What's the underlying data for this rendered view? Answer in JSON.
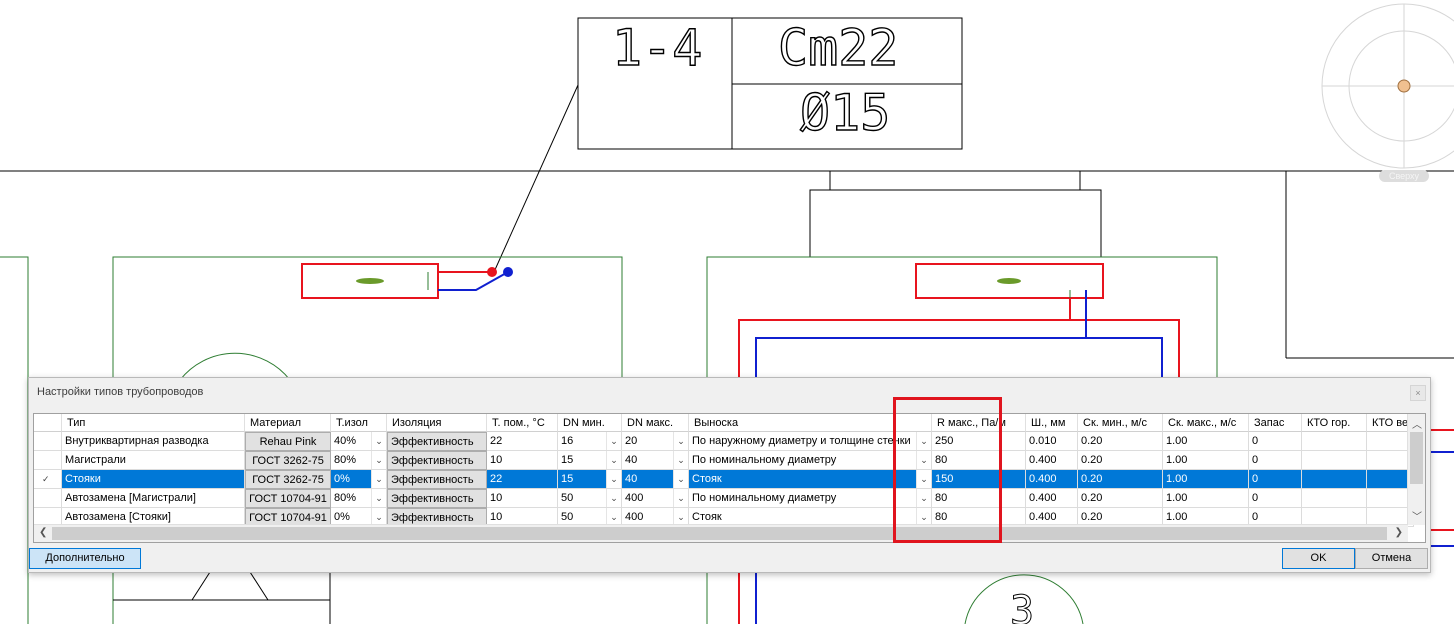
{
  "drawing": {
    "tag_left": "1-4",
    "tag_right_top": "Cm22",
    "tag_right_bottom": "Ø15",
    "bottom_glyph": "3",
    "compass_label": "Сверху"
  },
  "dialog": {
    "title": "Настройки типов трубопроводов",
    "close_glyph": "×",
    "columns": [
      "Тип",
      "Материал",
      "Т.изол",
      "Изоляция",
      "Т. пом., °С",
      "DN мин.",
      "DN макс.",
      "Выноска",
      "R макс., Па/м",
      "Ш., мм",
      "Ск. мин., м/с",
      "Ск. макс., м/с",
      "Запас",
      "КТО гор.",
      "КТО верт."
    ],
    "rows": [
      {
        "type": "Внутриквартирная разводка",
        "material": "Rehau Pink",
        "t_insul": "40%",
        "insulation": "Эффективность",
        "t_room": "22",
        "dn_min": "16",
        "dn_max": "20",
        "leader": "По наружному диаметру и толщине стенки",
        "r_max": "250",
        "roughness": "0.010",
        "v_min": "0.20",
        "v_max": "1.00",
        "reserve": "0",
        "kto_h": "",
        "kto_v": ""
      },
      {
        "type": "Магистрали",
        "material": "ГОСТ 3262-75",
        "t_insul": "80%",
        "insulation": "Эффективность",
        "t_room": "10",
        "dn_min": "15",
        "dn_max": "40",
        "leader": "По номинальному диаметру",
        "r_max": "80",
        "roughness": "0.400",
        "v_min": "0.20",
        "v_max": "1.00",
        "reserve": "0",
        "kto_h": "",
        "kto_v": ""
      },
      {
        "type": "Стояки",
        "material": "ГОСТ 3262-75",
        "t_insul": "0%",
        "insulation": "Эффективность",
        "t_room": "22",
        "dn_min": "15",
        "dn_max": "40",
        "leader": "Стояк",
        "r_max": "150",
        "roughness": "0.400",
        "v_min": "0.20",
        "v_max": "1.00",
        "reserve": "0",
        "kto_h": "",
        "kto_v": ""
      },
      {
        "type": "Автозамена [Магистрали]",
        "material": "ГОСТ 10704-91",
        "t_insul": "80%",
        "insulation": "Эффективность",
        "t_room": "10",
        "dn_min": "50",
        "dn_max": "400",
        "leader": "По номинальному диаметру",
        "r_max": "80",
        "roughness": "0.400",
        "v_min": "0.20",
        "v_max": "1.00",
        "reserve": "0",
        "kto_h": "",
        "kto_v": ""
      },
      {
        "type": "Автозамена [Стояки]",
        "material": "ГОСТ 10704-91",
        "t_insul": "0%",
        "insulation": "Эффективность",
        "t_room": "10",
        "dn_min": "50",
        "dn_max": "400",
        "leader": "Стояк",
        "r_max": "80",
        "roughness": "0.400",
        "v_min": "0.20",
        "v_max": "1.00",
        "reserve": "0",
        "kto_h": "",
        "kto_v": ""
      }
    ],
    "selected_row": 2,
    "row_marker": "✓",
    "more_button": "Дополнительно",
    "ok_button": "OK",
    "cancel_button": "Отмена"
  },
  "colors": {
    "selection": "#0078d7",
    "highlight": "#e0141e",
    "pipe_supply": "#e8141e",
    "pipe_return": "#1020d0",
    "wall_green": "#2e7d32"
  }
}
